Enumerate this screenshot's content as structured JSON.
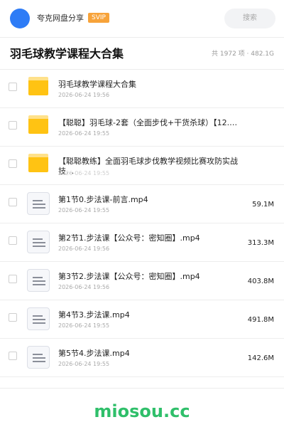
{
  "header": {
    "user_name": "夸克网盘分享",
    "badge": "SVIP",
    "search_placeholder": "搜索"
  },
  "folder": {
    "title": "羽毛球教学课程大合集",
    "stats": "共 1972 项 · 482.1G"
  },
  "files": [
    {
      "type": "folder",
      "name": "羽毛球教学课程大合集",
      "date": "2026-06-24 19:56",
      "size": ""
    },
    {
      "type": "folder",
      "name": "【聪聪】羽毛球-2套（全面步伐+干货杀球）【12.…",
      "date": "2026-06-24 19:55",
      "size": ""
    },
    {
      "type": "folder",
      "name": "【聪聪教练】全面羽毛球步伐教学视频比赛攻防实战技…",
      "date": "2026-06-24 19:55",
      "size": ""
    },
    {
      "type": "video",
      "name": "第1节0.步法课-前言.mp4",
      "date": "2026-06-24 19:55",
      "size": "59.1M"
    },
    {
      "type": "video",
      "name": "第2节1.步法课【公众号：密知圈】.mp4",
      "date": "2026-06-24 19:56",
      "size": "313.3M"
    },
    {
      "type": "video",
      "name": "第3节2.步法课【公众号：密知圈】.mp4",
      "date": "2026-06-24 19:56",
      "size": "403.8M"
    },
    {
      "type": "video",
      "name": "第4节3.步法课.mp4",
      "date": "2026-06-24 19:55",
      "size": "491.8M"
    },
    {
      "type": "video",
      "name": "第5节4.步法课.mp4",
      "date": "2026-06-24 19:55",
      "size": "142.6M"
    }
  ],
  "footer": {
    "watermark": "miosou.cc"
  },
  "colors": {
    "accent": "#2e7cf6",
    "svip": "#f7a33a",
    "folder": "#ffc313",
    "watermark": "#2fbf6a"
  }
}
